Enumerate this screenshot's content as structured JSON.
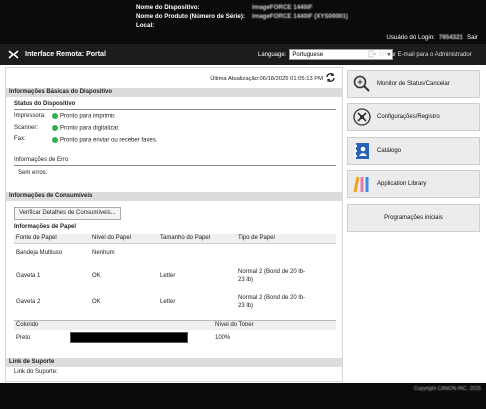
{
  "device": {
    "name_label": "Nome do Dispositivo:",
    "name_value": "imageFORCE 1440iF",
    "product_label": "Nome do Produto (Número de Série):",
    "product_value": "imageFORCE 1440iF (XYS00001)",
    "location_label": "Local:",
    "location_value": ""
  },
  "user": {
    "login_label": "Usuário do Login:",
    "login_value": "7654321",
    "logout": "Sair"
  },
  "nav": {
    "title": "Interface Remota: Portal",
    "language_label": "Language:",
    "language_value": "Portuguese",
    "send_mail": "Enviar E-mail para o Administrador"
  },
  "main": {
    "last_update": "Última Atualização:06/18/2025 01:05:13 PM",
    "basic_info_header": "Informações Básicas do Dispositivo",
    "device_status_title": "Status do Dispositivo",
    "status_rows": [
      {
        "label": "Impressora:",
        "value": "Pronto para imprimir."
      },
      {
        "label": "Scanner:",
        "value": "Pronto para digitalizar."
      },
      {
        "label": "Fax:",
        "value": "Pronto para enviar ou receber faxes."
      }
    ],
    "error_title": "Informações de Erro",
    "error_value": "Sem erros.",
    "consumables_header": "Informações de Consumíveis",
    "check_button": "Verificar Detalhes de Consumíveis...",
    "paper_title": "Informações de Papel",
    "paper_columns": [
      "Fonte de Papel",
      "Nível do Papel",
      "Tamanho do Papel",
      "Tipo de Papel"
    ],
    "paper_rows": [
      {
        "source": "Bandeja Multiuso",
        "level": "Nenhum",
        "size": "",
        "type": ""
      },
      {
        "source": "Gaveta 1",
        "level": "OK",
        "size": "Letter",
        "type": "Normal 2 (Bond de 20 lb-23 lb)"
      },
      {
        "source": "Gaveta 2",
        "level": "OK",
        "size": "Letter",
        "type": "Normal 2 (Bond de 20 lb-23 lb)"
      }
    ],
    "toner_columns": [
      "Colorido",
      "",
      "Nível do Toner"
    ],
    "toner_rows": [
      {
        "color": "Preto",
        "level": "100%"
      }
    ],
    "support_header": "Link de Suporte",
    "support_label": "Link do Suporte:"
  },
  "sidebar": {
    "items": [
      {
        "label": "Monitor de Status/Cancelar",
        "icon": "status-monitor-icon"
      },
      {
        "label": "Configurações/Registro",
        "icon": "settings-icon"
      },
      {
        "label": "Catálogo",
        "icon": "address-book-icon"
      },
      {
        "label": "Application Library",
        "icon": "application-library-icon"
      },
      {
        "label": "Programações iniciais",
        "icon": ""
      }
    ]
  },
  "footer": {
    "copyright": "Copyright CANON INC. 2025"
  },
  "colors": {
    "topbar": "#0b0b0b",
    "navbar": "#1c1c1c",
    "status_ok": "#2fb14a",
    "section_header": "#dcdcdc",
    "sidebar_button": "#ececec"
  }
}
